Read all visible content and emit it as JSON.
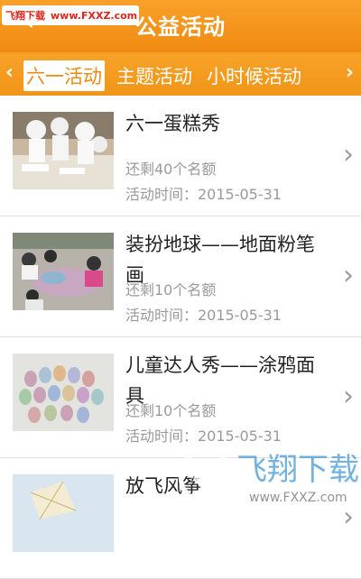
{
  "watermark_top": {
    "site_cn": "飞翔下载",
    "site_url": "www.FXXZ.com"
  },
  "header": {
    "back_icon": "back-arrow-icon",
    "title": "公益活动"
  },
  "tabs": {
    "items": [
      {
        "label": "六一活动",
        "active": true
      },
      {
        "label": "主题活动",
        "active": false
      },
      {
        "label": "小时候活动",
        "active": false
      }
    ]
  },
  "items": [
    {
      "title": "六一蛋糕秀",
      "quota": "还剩40个名额",
      "date": "活动时间：2015-05-31"
    },
    {
      "title": "装扮地球——地面粉笔画",
      "quota": "还剩10个名额",
      "date": "活动时间：2015-05-31"
    },
    {
      "title": "儿童达人秀——涂鸦面具",
      "quota": "还剩10个名额",
      "date": "活动时间：2015-05-31"
    },
    {
      "title": "放飞风筝",
      "quota": "",
      "date": ""
    }
  ],
  "watermark_bottom": {
    "brand": "飞翔下载",
    "url": "www.FXXZ.com"
  },
  "colors": {
    "accent": "#f08a10",
    "header_top": "#f8a12a",
    "text_secondary": "#9a9a9a"
  }
}
